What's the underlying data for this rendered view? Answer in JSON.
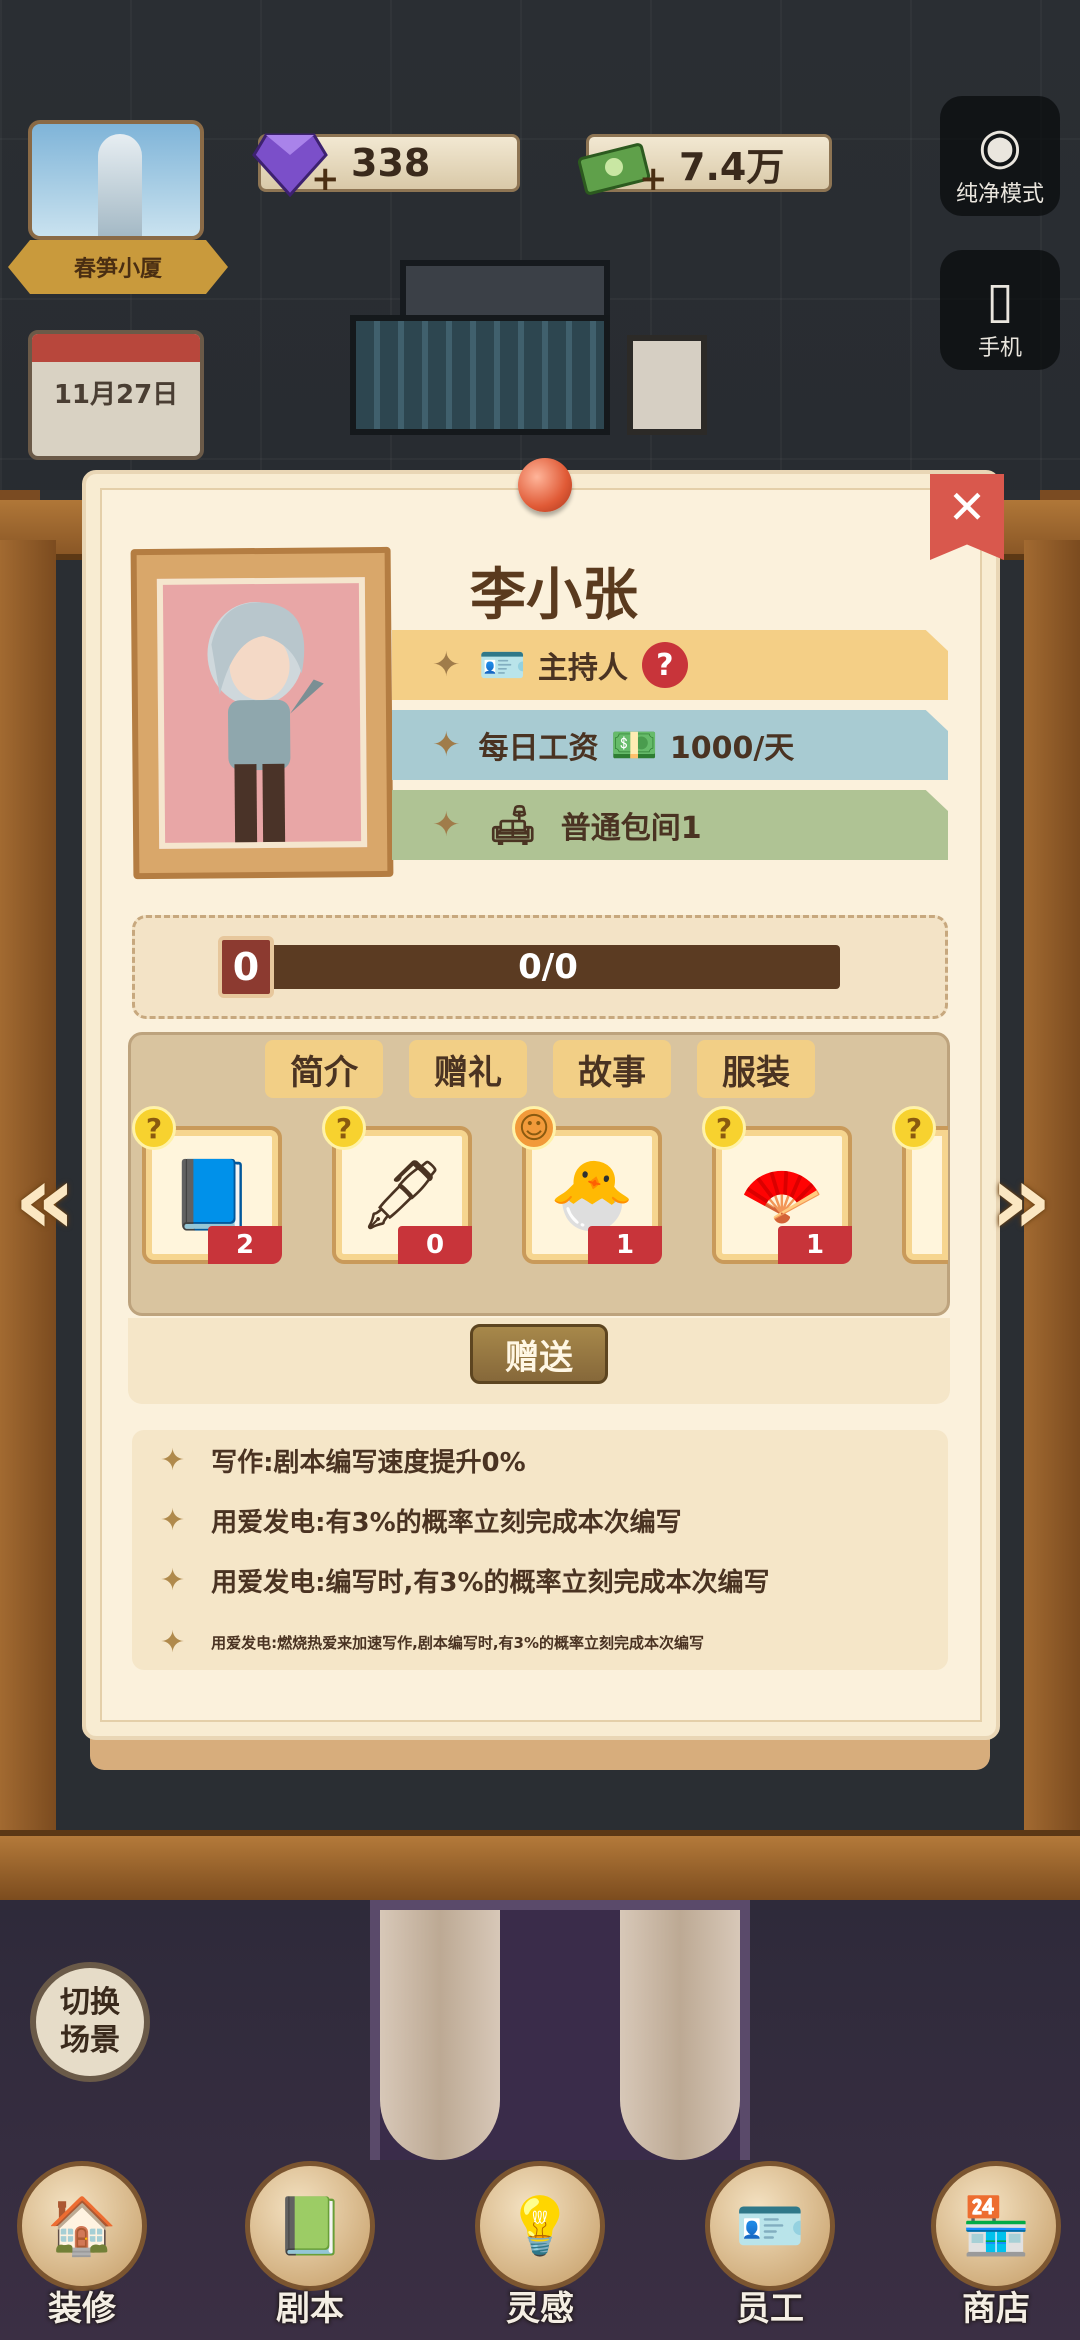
{
  "hud": {
    "building_name": "春笋小厦",
    "date": "11月27日",
    "gems": "338",
    "cash": "7.4万",
    "pure_mode": "纯净模式",
    "phone": "手机"
  },
  "profile": {
    "name": "李小张",
    "role": "主持人",
    "salary_label": "每日工资",
    "salary_value": "1000/天",
    "room": "普通包间1",
    "favor_level": "0",
    "favor_progress": "0/0"
  },
  "tabs": [
    "简介",
    "赠礼",
    "故事",
    "服装"
  ],
  "gifts": [
    {
      "icon": "magazine-icon",
      "count": "2",
      "badge": "?"
    },
    {
      "icon": "fountain-pen-icon",
      "count": "0",
      "badge": "?"
    },
    {
      "icon": "plush-toy-icon",
      "count": "1",
      "badge": "smile"
    },
    {
      "icon": "folding-fan-icon",
      "count": "1",
      "badge": "?"
    },
    {
      "icon": "gift-partial-icon",
      "count": "",
      "badge": "?"
    }
  ],
  "give_button": "赠送",
  "skills": [
    "写作:剧本编写速度提升0%",
    "用爱发电:有3%的概率立刻完成本次编写",
    "用爱发电:编写时,有3%的概率立刻完成本次编写",
    "用爱发电:燃烧热爱来加速写作,剧本编写时,有3%的概率立刻完成本次编写"
  ],
  "switch_scene": [
    "切换",
    "场景"
  ],
  "nav": [
    "装修",
    "剧本",
    "灵感",
    "员工",
    "商店"
  ],
  "colors": {
    "card_bg": "#fbf1dc",
    "role_ribbon": "#f4cf86",
    "salary_ribbon": "#a8cbd2",
    "room_ribbon": "#afc394",
    "close_button": "#d9584d",
    "badge_red": "#c8343a"
  }
}
